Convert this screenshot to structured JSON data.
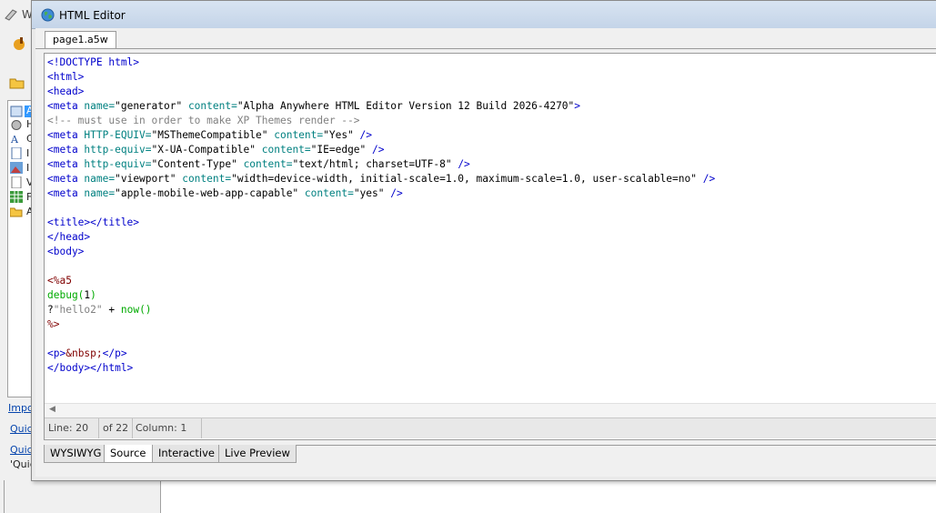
{
  "background_window": {
    "title_fragment": "W",
    "tree_labels": [
      "A",
      "H",
      "C",
      "I",
      "I",
      "V",
      "F",
      "A"
    ],
    "links": [
      "Impor",
      "Quick",
      "Quick"
    ],
    "quote_text": "'Quic"
  },
  "editor": {
    "title": "HTML Editor",
    "icon": "globe-icon",
    "doc_tab": "page1.a5w",
    "code_lines": [
      [
        [
          "t-tag",
          "<!DOCTYPE html>"
        ]
      ],
      [
        [
          "t-tag",
          "<html>"
        ]
      ],
      [
        [
          "t-tag",
          "<head>"
        ]
      ],
      [
        [
          "t-tag",
          "<meta "
        ],
        [
          "t-attr",
          "name="
        ],
        [
          "t-val",
          "\"generator\" "
        ],
        [
          "t-attr",
          "content="
        ],
        [
          "t-val",
          "\"Alpha Anywhere HTML Editor Version 12 Build 2026-4270\""
        ],
        [
          "t-tag",
          ">"
        ]
      ],
      [
        [
          "t-cmt",
          "<!-- must use in order to make XP Themes render -->"
        ]
      ],
      [
        [
          "t-tag",
          "<meta "
        ],
        [
          "t-attr",
          "HTTP-EQUIV="
        ],
        [
          "t-val",
          "\"MSThemeCompatible\" "
        ],
        [
          "t-attr",
          "content="
        ],
        [
          "t-val",
          "\"Yes\" "
        ],
        [
          "t-tag",
          "/>"
        ]
      ],
      [
        [
          "t-tag",
          "<meta "
        ],
        [
          "t-attr",
          "http-equiv="
        ],
        [
          "t-val",
          "\"X-UA-Compatible\" "
        ],
        [
          "t-attr",
          "content="
        ],
        [
          "t-val",
          "\"IE=edge\" "
        ],
        [
          "t-tag",
          "/>"
        ]
      ],
      [
        [
          "t-tag",
          "<meta "
        ],
        [
          "t-attr",
          "http-equiv="
        ],
        [
          "t-val",
          "\"Content-Type\" "
        ],
        [
          "t-attr",
          "content="
        ],
        [
          "t-val",
          "\"text/html; charset=UTF-8\" "
        ],
        [
          "t-tag",
          "/>"
        ]
      ],
      [
        [
          "t-tag",
          "<meta "
        ],
        [
          "t-attr",
          "name="
        ],
        [
          "t-val",
          "\"viewport\" "
        ],
        [
          "t-attr",
          "content="
        ],
        [
          "t-val",
          "\"width=device-width, initial-scale=1.0, maximum-scale=1.0, user-scalable=no\" "
        ],
        [
          "t-tag",
          "/>"
        ]
      ],
      [
        [
          "t-tag",
          "<meta "
        ],
        [
          "t-attr",
          "name="
        ],
        [
          "t-val",
          "\"apple-mobile-web-app-capable\" "
        ],
        [
          "t-attr",
          "content="
        ],
        [
          "t-val",
          "\"yes\" "
        ],
        [
          "t-tag",
          "/>"
        ]
      ],
      [],
      [
        [
          "t-tag",
          "<title></title>"
        ]
      ],
      [
        [
          "t-tag",
          "</head>"
        ]
      ],
      [
        [
          "t-tag",
          "<body>"
        ]
      ],
      [],
      [
        [
          "t-ent",
          "<%a5"
        ]
      ],
      [
        [
          "t-fn",
          "debug("
        ],
        [
          "t-num",
          "1"
        ],
        [
          "t-fn",
          ")"
        ]
      ],
      [
        [
          "t-plain",
          "?"
        ],
        [
          "t-str",
          "\"hello2\" "
        ],
        [
          "t-plain",
          "+ "
        ],
        [
          "t-fn",
          "now()"
        ]
      ],
      [
        [
          "t-ent",
          "%>"
        ]
      ],
      [],
      [
        [
          "t-tag",
          "<p>"
        ],
        [
          "t-ent",
          "&nbsp;"
        ],
        [
          "t-tag",
          "</p>"
        ]
      ],
      [
        [
          "t-tag",
          "</body></html>"
        ]
      ]
    ],
    "status": {
      "line": "Line: 20",
      "of": "of 22",
      "column": "Column: 1"
    },
    "bottom_tabs": [
      "WYSIWYG",
      "Source",
      "Interactive",
      "Live Preview"
    ],
    "active_tab": "Source"
  }
}
